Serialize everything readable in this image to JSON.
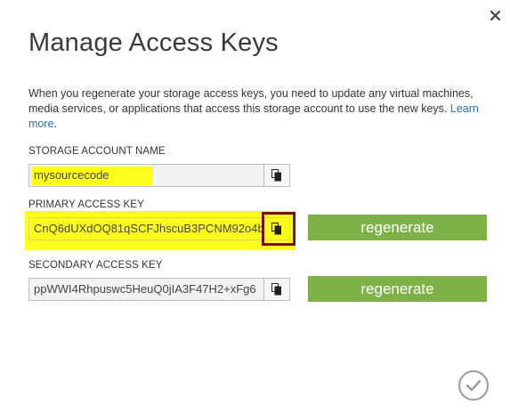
{
  "dialog": {
    "title": "Manage Access Keys",
    "description": "When you regenerate your storage access keys, you need to update any virtual machines, media services, or applications that access this storage account to use the new keys.",
    "learn_more": "Learn more",
    "close_icon": "close-icon",
    "confirm_icon": "checkmark-icon"
  },
  "storage_account": {
    "label": "STORAGE ACCOUNT NAME",
    "value": "mysourcecode"
  },
  "primary_key": {
    "label": "PRIMARY ACCESS KEY",
    "value": "CnQ6dUXdOQ81qSCFJhscuB3PCNM92o4b",
    "regenerate_label": "regenerate"
  },
  "secondary_key": {
    "label": "SECONDARY ACCESS KEY",
    "value": "ppWWI4Rhpuswc5HeuQ0jIA3F47H2+xFg6",
    "regenerate_label": "regenerate"
  },
  "colors": {
    "accent_green": "#7eb248",
    "highlight_yellow": "#ffff1e",
    "highlight_border": "#7a1010"
  }
}
